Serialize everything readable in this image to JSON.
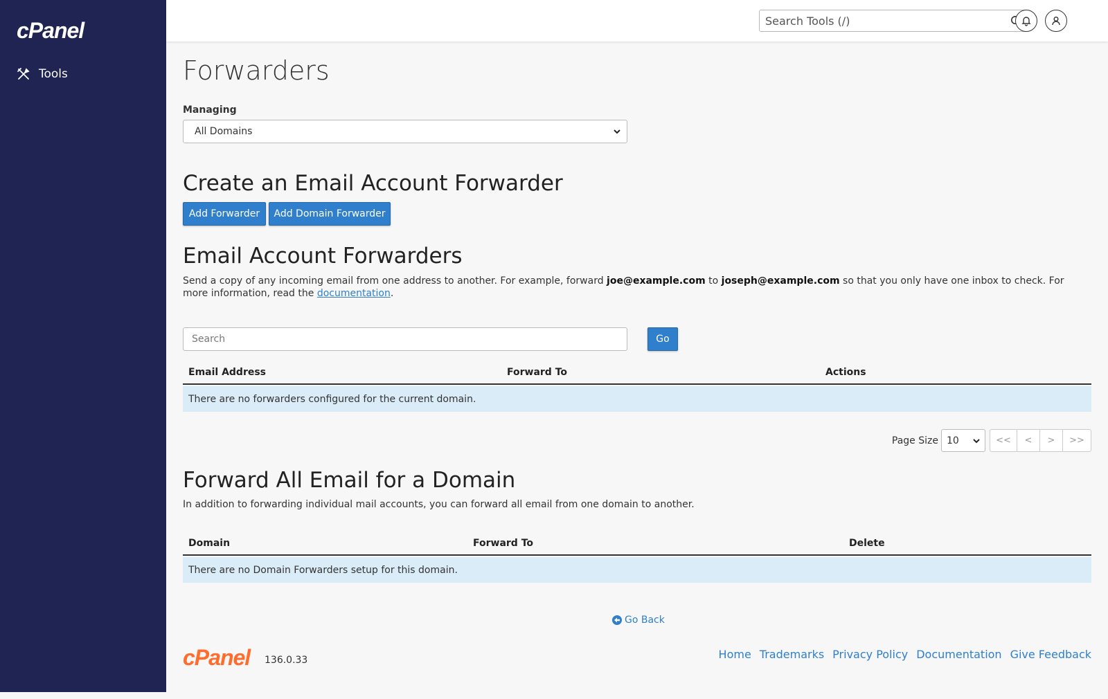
{
  "sidebar": {
    "brand": "cPanel",
    "items": [
      {
        "label": "Tools",
        "icon": "tools-icon"
      }
    ]
  },
  "topbar": {
    "search_placeholder": "Search Tools (/)",
    "icons": [
      "search-icon",
      "bell-icon",
      "user-icon"
    ]
  },
  "page": {
    "title": "Forwarders",
    "managing_label": "Managing",
    "managing_value": "All Domains"
  },
  "create_section": {
    "heading": "Create an Email Account Forwarder",
    "add_forwarder": "Add Forwarder",
    "add_domain_forwarder": "Add Domain Forwarder"
  },
  "account_forwarders": {
    "heading": "Email Account Forwarders",
    "desc_pre": "Send a copy of any incoming email from one address to another. For example, forward ",
    "desc_ex1": "joe@example.com",
    "desc_mid": " to ",
    "desc_ex2": "joseph@example.com",
    "desc_post": " so that you only have one inbox to check. For more information, read the ",
    "desc_link": "documentation",
    "desc_end": ".",
    "search_placeholder": "Search",
    "go_label": "Go",
    "columns": [
      "Email Address",
      "Forward To",
      "Actions"
    ],
    "empty_message": "There are no forwarders configured for the current domain.",
    "page_size_label": "Page Size",
    "page_size_value": "10",
    "pager": [
      "<<",
      "<",
      ">",
      ">>"
    ]
  },
  "domain_forwarders": {
    "heading": "Forward All Email for a Domain",
    "desc": "In addition to forwarding individual mail accounts, you can forward all email from one domain to another.",
    "columns": [
      "Domain",
      "Forward To",
      "Delete"
    ],
    "empty_message": "There are no Domain Forwarders setup for this domain."
  },
  "go_back": "Go Back",
  "footer": {
    "logo": "cPanel",
    "version": "136.0.33",
    "links": [
      "Home",
      "Trademarks",
      "Privacy Policy",
      "Documentation",
      "Give Feedback"
    ]
  },
  "colors": {
    "sidebar_bg": "#1f2452",
    "primary": "#2f7fcc",
    "row_highlight": "#d9ecf7",
    "brand_orange": "#ff6c2c"
  }
}
